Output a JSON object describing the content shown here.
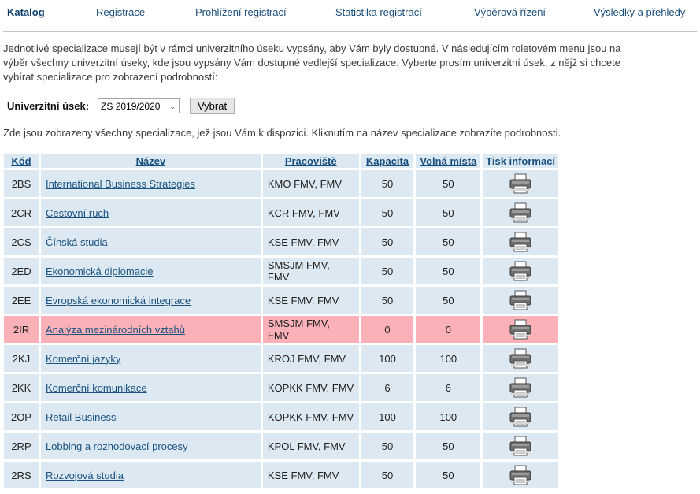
{
  "nav": {
    "items": [
      {
        "label": "Katalog",
        "active": true
      },
      {
        "label": "Registrace",
        "active": false
      },
      {
        "label": "Prohlížení registrací",
        "active": false
      },
      {
        "label": "Statistika registrací",
        "active": false
      },
      {
        "label": "Výběrová řízení",
        "active": false
      },
      {
        "label": "Výsledky a přehledy",
        "active": false
      }
    ]
  },
  "intro_text": "Jednotlivé specializace musejí být v rámci univerzitního úseku vypsány, aby Vám byly dostupné. V následujícím roletovém menu jsou na výběr všechny univerzitní úseky, kde jsou vypsány Vám dostupné vedlejší specializace. Vyberte prosím univerzitní úsek, z nějž si chcete vybírat specializace pro zobrazení podrobností:",
  "filter": {
    "label": "Univerzitní úsek:",
    "selected": "ZS 2019/2020",
    "button": "Vybrat"
  },
  "table_description": "Zde jsou zobrazeny všechny specializace, jež jsou Vám k dispozici. Kliknutím na název specializace zobrazíte podrobnosti.",
  "table": {
    "headers": {
      "code": "Kód",
      "name": "Název",
      "workplace": "Pracoviště",
      "capacity": "Kapacita",
      "free": "Volná místa",
      "print": "Tisk informací"
    },
    "rows": [
      {
        "code": "2BS",
        "name": "International Business Strategies",
        "workplace": "KMO FMV, FMV",
        "capacity": "50",
        "free": "50",
        "highlight": false
      },
      {
        "code": "2CR",
        "name": "Cestovní ruch",
        "workplace": "KCR FMV, FMV",
        "capacity": "50",
        "free": "50",
        "highlight": false
      },
      {
        "code": "2CS",
        "name": "Čínská studia",
        "workplace": "KSE FMV, FMV",
        "capacity": "50",
        "free": "50",
        "highlight": false
      },
      {
        "code": "2ED",
        "name": "Ekonomická diplomacie",
        "workplace": "SMSJM FMV, FMV",
        "capacity": "50",
        "free": "50",
        "highlight": false
      },
      {
        "code": "2EE",
        "name": "Evropská ekonomická integrace",
        "workplace": "KSE FMV, FMV",
        "capacity": "50",
        "free": "50",
        "highlight": false
      },
      {
        "code": "2IR",
        "name": "Analýza mezinárodních vztahů",
        "workplace": "SMSJM FMV, FMV",
        "capacity": "0",
        "free": "0",
        "highlight": true
      },
      {
        "code": "2KJ",
        "name": "Komerční jazyky",
        "workplace": "KROJ FMV, FMV",
        "capacity": "100",
        "free": "100",
        "highlight": false
      },
      {
        "code": "2KK",
        "name": "Komerční komunikace",
        "workplace": "KOPKK FMV, FMV",
        "capacity": "6",
        "free": "6",
        "highlight": false
      },
      {
        "code": "2OP",
        "name": "Retail Business",
        "workplace": "KOPKK FMV, FMV",
        "capacity": "100",
        "free": "100",
        "highlight": false
      },
      {
        "code": "2RP",
        "name": "Lobbing a rozhodovací procesy",
        "workplace": "KPOL FMV, FMV",
        "capacity": "50",
        "free": "50",
        "highlight": false
      },
      {
        "code": "2RS",
        "name": "Rozvojová studia",
        "workplace": "KSE FMV, FMV",
        "capacity": "50",
        "free": "50",
        "highlight": false
      }
    ],
    "print_icon": "printer-icon"
  }
}
